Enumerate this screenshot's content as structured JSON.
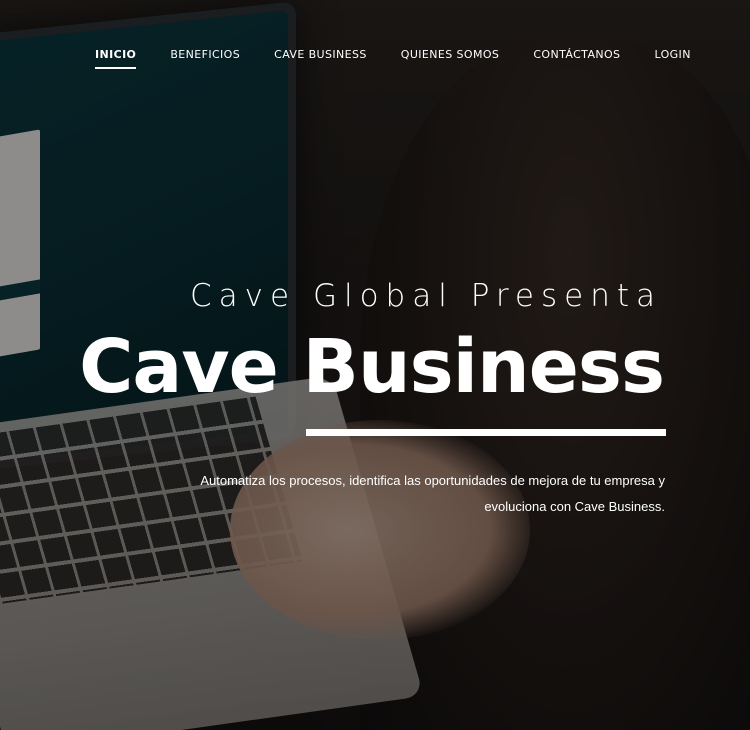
{
  "nav": {
    "items": [
      {
        "label": "INICIO",
        "active": true
      },
      {
        "label": "BENEFICIOS",
        "active": false
      },
      {
        "label": "CAVE BUSINESS",
        "active": false
      },
      {
        "label": "QUIENES SOMOS",
        "active": false
      },
      {
        "label": "CONTÁCTANOS",
        "active": false
      },
      {
        "label": "LOGIN",
        "active": false
      }
    ]
  },
  "hero": {
    "presenta": "Cave Global Presenta",
    "title": "Cave Business",
    "subtitle_line1": "Automatiza los procesos, identifica las oportunidades de mejora de tu empresa y",
    "subtitle_line2": "evoluciona con Cave Business."
  },
  "colors": {
    "text": "#ffffff",
    "overlay": "#000000",
    "screen": "#0c3b43"
  }
}
